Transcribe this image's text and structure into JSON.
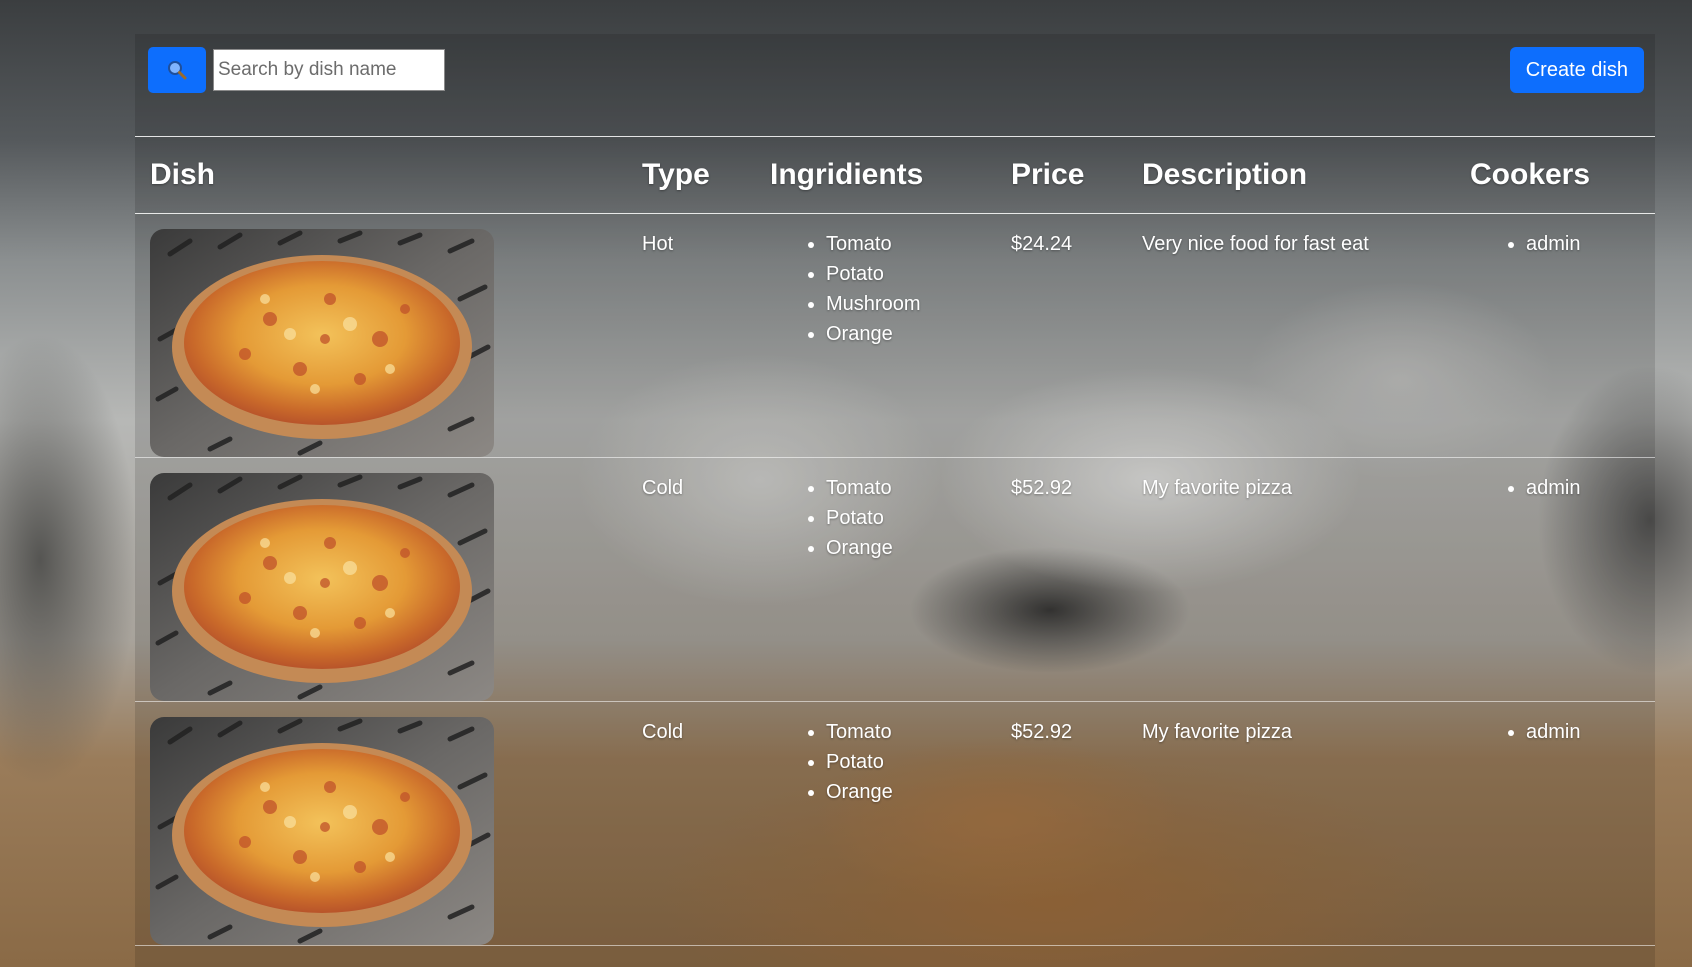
{
  "toolbar": {
    "search_icon": "search-icon",
    "search_placeholder": "Search by dish name",
    "search_value": "",
    "create_label": "Create dish",
    "accent_color": "#0d6efd"
  },
  "table": {
    "headers": {
      "dish": "Dish",
      "type": "Type",
      "ingredients": "Ingridients",
      "price": "Price",
      "description": "Description",
      "cookers": "Cookers"
    },
    "rows": [
      {
        "image": "pizza-image",
        "type": "Hot",
        "ingredients": [
          "Tomato",
          "Potato",
          "Mushroom",
          "Orange"
        ],
        "price": "$24.24",
        "description": "Very nice food for fast eat",
        "cookers": [
          "admin"
        ]
      },
      {
        "image": "pizza-image",
        "type": "Cold",
        "ingredients": [
          "Tomato",
          "Potato",
          "Orange"
        ],
        "price": "$52.92",
        "description": "My favorite pizza",
        "cookers": [
          "admin"
        ]
      },
      {
        "image": "pizza-image",
        "type": "Cold",
        "ingredients": [
          "Tomato",
          "Potato",
          "Orange"
        ],
        "price": "$52.92",
        "description": "My favorite pizza",
        "cookers": [
          "admin"
        ]
      }
    ]
  }
}
